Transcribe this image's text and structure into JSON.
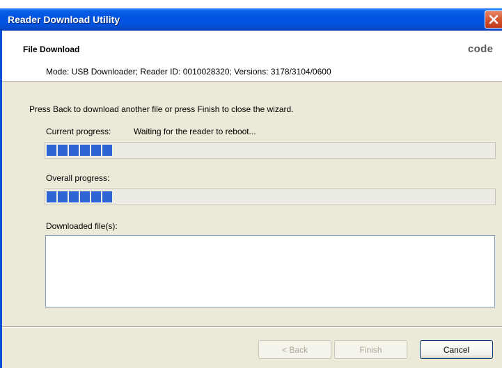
{
  "window": {
    "title": "Reader Download Utility",
    "close_icon": "close-icon"
  },
  "header": {
    "title": "File Download",
    "logo_text": "code",
    "mode_line": "Mode: USB Downloader; Reader ID: 0010028320; Versions: 3178/3104/0600"
  },
  "body": {
    "instruction": "Press Back to download another file or press Finish to close the wizard.",
    "current_label": "Current progress:",
    "current_status": "Waiting for the reader to reboot...",
    "current_progress_blocks": 6,
    "overall_label": "Overall progress:",
    "overall_progress_blocks": 6,
    "files_label": "Downloaded file(s):",
    "files": []
  },
  "buttons": {
    "back": "< Back",
    "finish": "Finish",
    "cancel": "Cancel"
  },
  "colors": {
    "titlebar": "#0054e3",
    "progress_fill": "#2d66d2",
    "dialog_bg": "#ece9d8"
  }
}
